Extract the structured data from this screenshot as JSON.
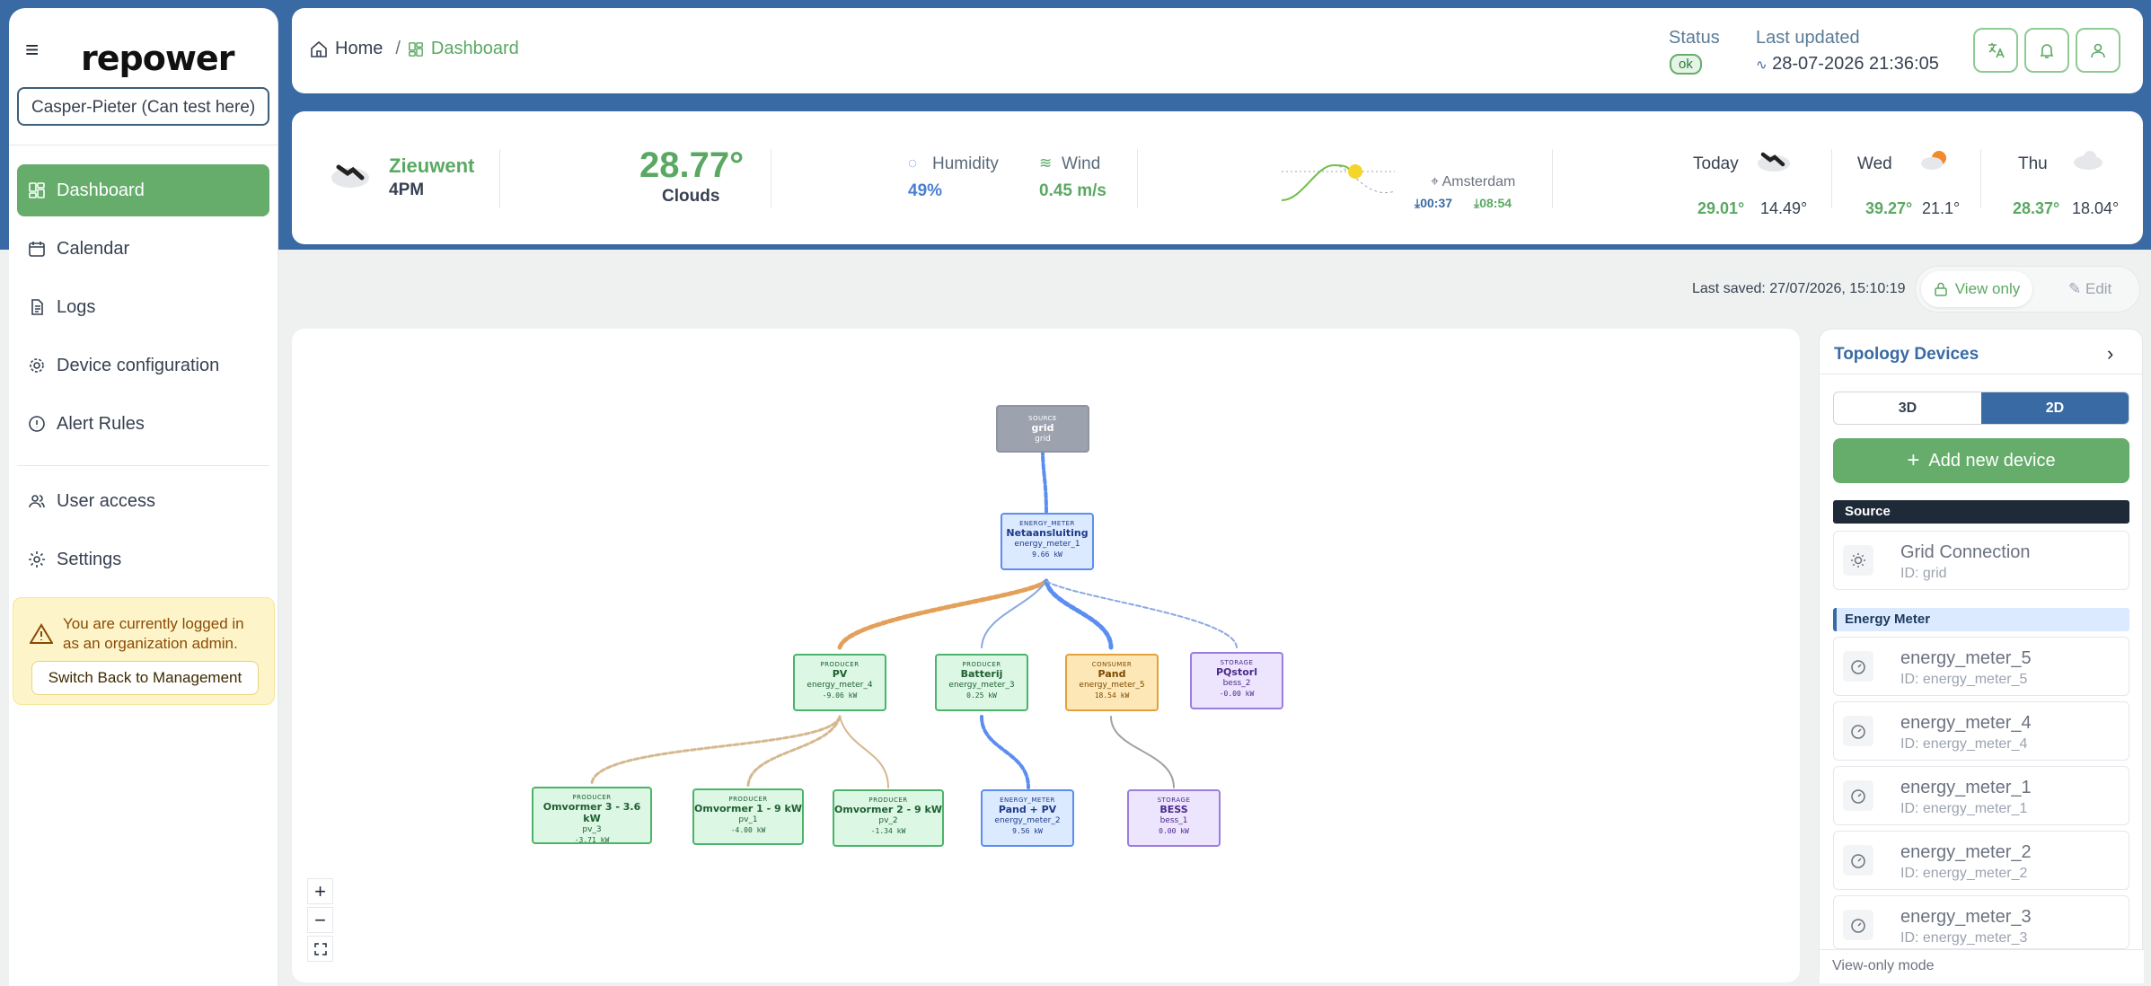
{
  "sidebar": {
    "logo": "repower",
    "org_value": "Casper-Pieter (Can test here)",
    "items": [
      {
        "label": "Dashboard"
      },
      {
        "label": "Calendar"
      },
      {
        "label": "Logs"
      },
      {
        "label": "Device configuration"
      },
      {
        "label": "Alert Rules"
      },
      {
        "label": "User access"
      },
      {
        "label": "Settings"
      }
    ],
    "alert": {
      "text": "You are currently logged in as an organization admin.",
      "button": "Switch Back to Management"
    }
  },
  "header": {
    "breadcrumb_home": "Home",
    "breadcrumb_sep": "/",
    "breadcrumb_current": "Dashboard",
    "status_label": "Status",
    "status_value": "ok",
    "updated_label": "Last updated",
    "updated_value": "28-07-2026 21:36:05"
  },
  "weather": {
    "city": "Zieuwent",
    "time": "4PM",
    "temp": "28.77°",
    "condition": "Clouds",
    "humidity_label": "Humidity",
    "humidity_value": "49%",
    "wind_label": "Wind",
    "wind_value": "0.45 m/s",
    "location": "Amsterdam",
    "sunrise": "00:37",
    "sunset": "08:54",
    "forecast": [
      {
        "day": "Today",
        "high": "29.01°",
        "low": "14.49°"
      },
      {
        "day": "Wed",
        "high": "39.27°",
        "low": "21.1°"
      },
      {
        "day": "Thu",
        "high": "28.37°",
        "low": "18.04°"
      }
    ]
  },
  "toolbar": {
    "last_saved": "Last saved: 27/07/2026, 15:10:19",
    "view_only": "View only",
    "edit": "Edit"
  },
  "topology": {
    "nodes": [
      {
        "type": "SOURCE",
        "name": "grid",
        "sub": "grid",
        "value": ""
      },
      {
        "type": "ENERGY_METER",
        "name": "Netaansluiting",
        "sub": "energy_meter_1",
        "value": "9.66 kW"
      },
      {
        "type": "PRODUCER",
        "name": "PV",
        "sub": "energy_meter_4",
        "value": "-9.06 kW"
      },
      {
        "type": "PRODUCER",
        "name": "Batterij",
        "sub": "energy_meter_3",
        "value": "0.25 kW"
      },
      {
        "type": "CONSUMER",
        "name": "Pand",
        "sub": "energy_meter_5",
        "value": "18.54 kW"
      },
      {
        "type": "STORAGE",
        "name": "PQstorl",
        "sub": "bess_2",
        "value": "-0.00 kW"
      },
      {
        "type": "PRODUCER",
        "name": "Omvormer 3 - 3.6 kW",
        "sub": "pv_3",
        "value": "-3.71 kW"
      },
      {
        "type": "PRODUCER",
        "name": "Omvormer 1 - 9 kW",
        "sub": "pv_1",
        "value": "-4.00 kW"
      },
      {
        "type": "PRODUCER",
        "name": "Omvormer 2 - 9 kW",
        "sub": "pv_2",
        "value": "-1.34 kW"
      },
      {
        "type": "ENERGY_METER",
        "name": "Pand + PV",
        "sub": "energy_meter_2",
        "value": "9.56 kW"
      },
      {
        "type": "STORAGE",
        "name": "BESS",
        "sub": "bess_1",
        "value": "0.00 kW"
      }
    ],
    "zoom_in": "+",
    "zoom_out": "−"
  },
  "panel": {
    "title": "Topology Devices",
    "toggle_3d": "3D",
    "toggle_2d": "2D",
    "add_button": "Add new device",
    "group_source": "Source",
    "source_device": {
      "name": "Grid Connection",
      "id": "ID: grid"
    },
    "group_meter": "Energy Meter",
    "meters": [
      {
        "name": "energy_meter_5",
        "id": "ID: energy_meter_5"
      },
      {
        "name": "energy_meter_4",
        "id": "ID: energy_meter_4"
      },
      {
        "name": "energy_meter_1",
        "id": "ID: energy_meter_1"
      },
      {
        "name": "energy_meter_2",
        "id": "ID: energy_meter_2"
      },
      {
        "name": "energy_meter_3",
        "id": "ID: energy_meter_3"
      }
    ],
    "footer": "View-only mode"
  },
  "colors": {
    "primary_green": "#66ad6c",
    "brand_blue": "#3a6aa3"
  }
}
